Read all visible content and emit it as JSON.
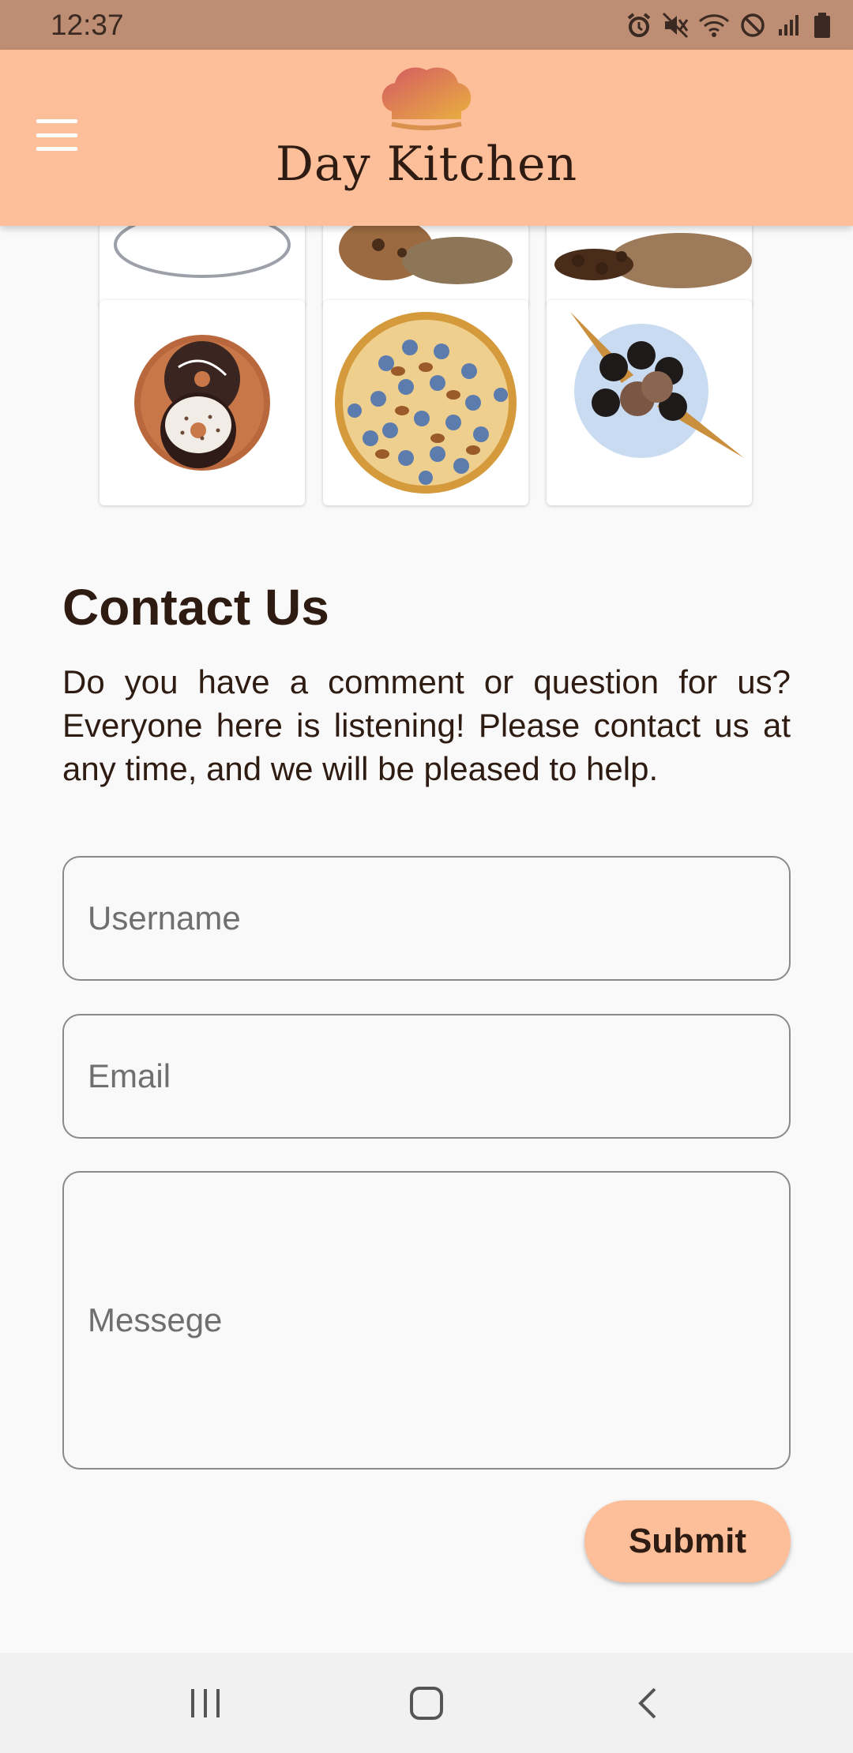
{
  "status_bar": {
    "time": "12:37",
    "icons": [
      "alarm-icon",
      "mute-icon",
      "wifi-icon",
      "do-not-disturb-icon",
      "signal-icon",
      "battery-icon"
    ]
  },
  "header": {
    "brand": "Day Kitchen",
    "menu_icon": "hamburger-menu-icon",
    "background": "#fdbe9a"
  },
  "gallery": {
    "items": [
      {
        "name": "plate"
      },
      {
        "name": "cookies"
      },
      {
        "name": "coffee-beans"
      },
      {
        "name": "donuts"
      },
      {
        "name": "blueberry-tart"
      },
      {
        "name": "cookie-ice-cream-cones"
      }
    ]
  },
  "contact": {
    "title": "Contact Us",
    "description": "Do you have a comment or question for us? Everyone here is listening! Please contact us at any time, and we will be pleased to help.",
    "username_placeholder": "Username",
    "email_placeholder": "Email",
    "message_placeholder": "Messege",
    "submit_label": "Submit"
  },
  "nav_bar": {
    "buttons": [
      "recent-apps-icon",
      "home-icon",
      "back-icon"
    ]
  },
  "colors": {
    "accent": "#fdbe9a",
    "status_bar": "#be8e74",
    "text": "#2e1b12"
  }
}
